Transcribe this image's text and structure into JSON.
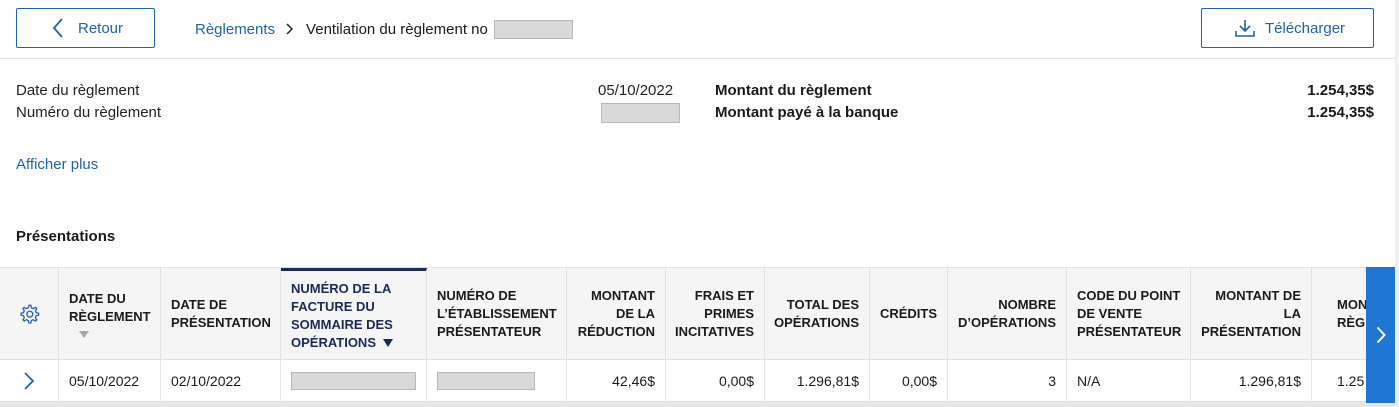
{
  "toolbar": {
    "back_label": "Retour",
    "download_label": "Télécharger"
  },
  "breadcrumb": {
    "root": "Règlements",
    "current": "Ventilation du règlement no"
  },
  "summary": {
    "date_label": "Date du règlement",
    "date_value": "05/10/2022",
    "number_label": "Numéro du règlement",
    "settlement_amount_label": "Montant du règlement",
    "settlement_amount_value": "1.254,35$",
    "bank_amount_label": "Montant payé à la banque",
    "bank_amount_value": "1.254,35$"
  },
  "show_more_label": "Afficher plus",
  "section_title": "Présentations",
  "table": {
    "headers": {
      "settlement_date": "DATE DU RÈGLEMENT",
      "presentation_date": "DATE DE PRÉSENTATION",
      "invoice_number": "NUMÉRO DE LA FACTURE DU SOMMAIRE DES OPÉRATIONS",
      "merchant_number": "NUMÉRO DE L’ÉTABLISSEMENT PRÉSENTATEUR",
      "discount_amount": "MONTANT DE LA RÉDUCTION",
      "fees": "FRAIS ET PRIMES INCITATIVES",
      "total_operations": "TOTAL DES OPÉRATIONS",
      "credits": "CRÉDITS",
      "operation_count": "NOMBRE D’OPÉRATIONS",
      "pos_code": "CODE DU POINT DE VENTE PRÉSENTATEUR",
      "presentation_amount": "MONTANT DE LA PRÉSENTATION",
      "settlement_amount_partial": "MON RÈGLE"
    },
    "rows": [
      {
        "settlement_date": "05/10/2022",
        "presentation_date": "02/10/2022",
        "discount_amount": "42,46$",
        "fees": "0,00$",
        "total_operations": "1.296,81$",
        "credits": "0,00$",
        "operation_count": "3",
        "pos_code": "N/A",
        "presentation_amount": "1.296,81$",
        "settlement_amount_partial": "1.25"
      }
    ]
  },
  "colors": {
    "link_blue": "#1f62a8",
    "active_header": "#1b2a55",
    "next_button": "#1e76d2"
  },
  "icons": [
    "chevron-left-icon",
    "chevron-right-icon",
    "download-icon",
    "gear-icon",
    "sort-desc-icon"
  ]
}
